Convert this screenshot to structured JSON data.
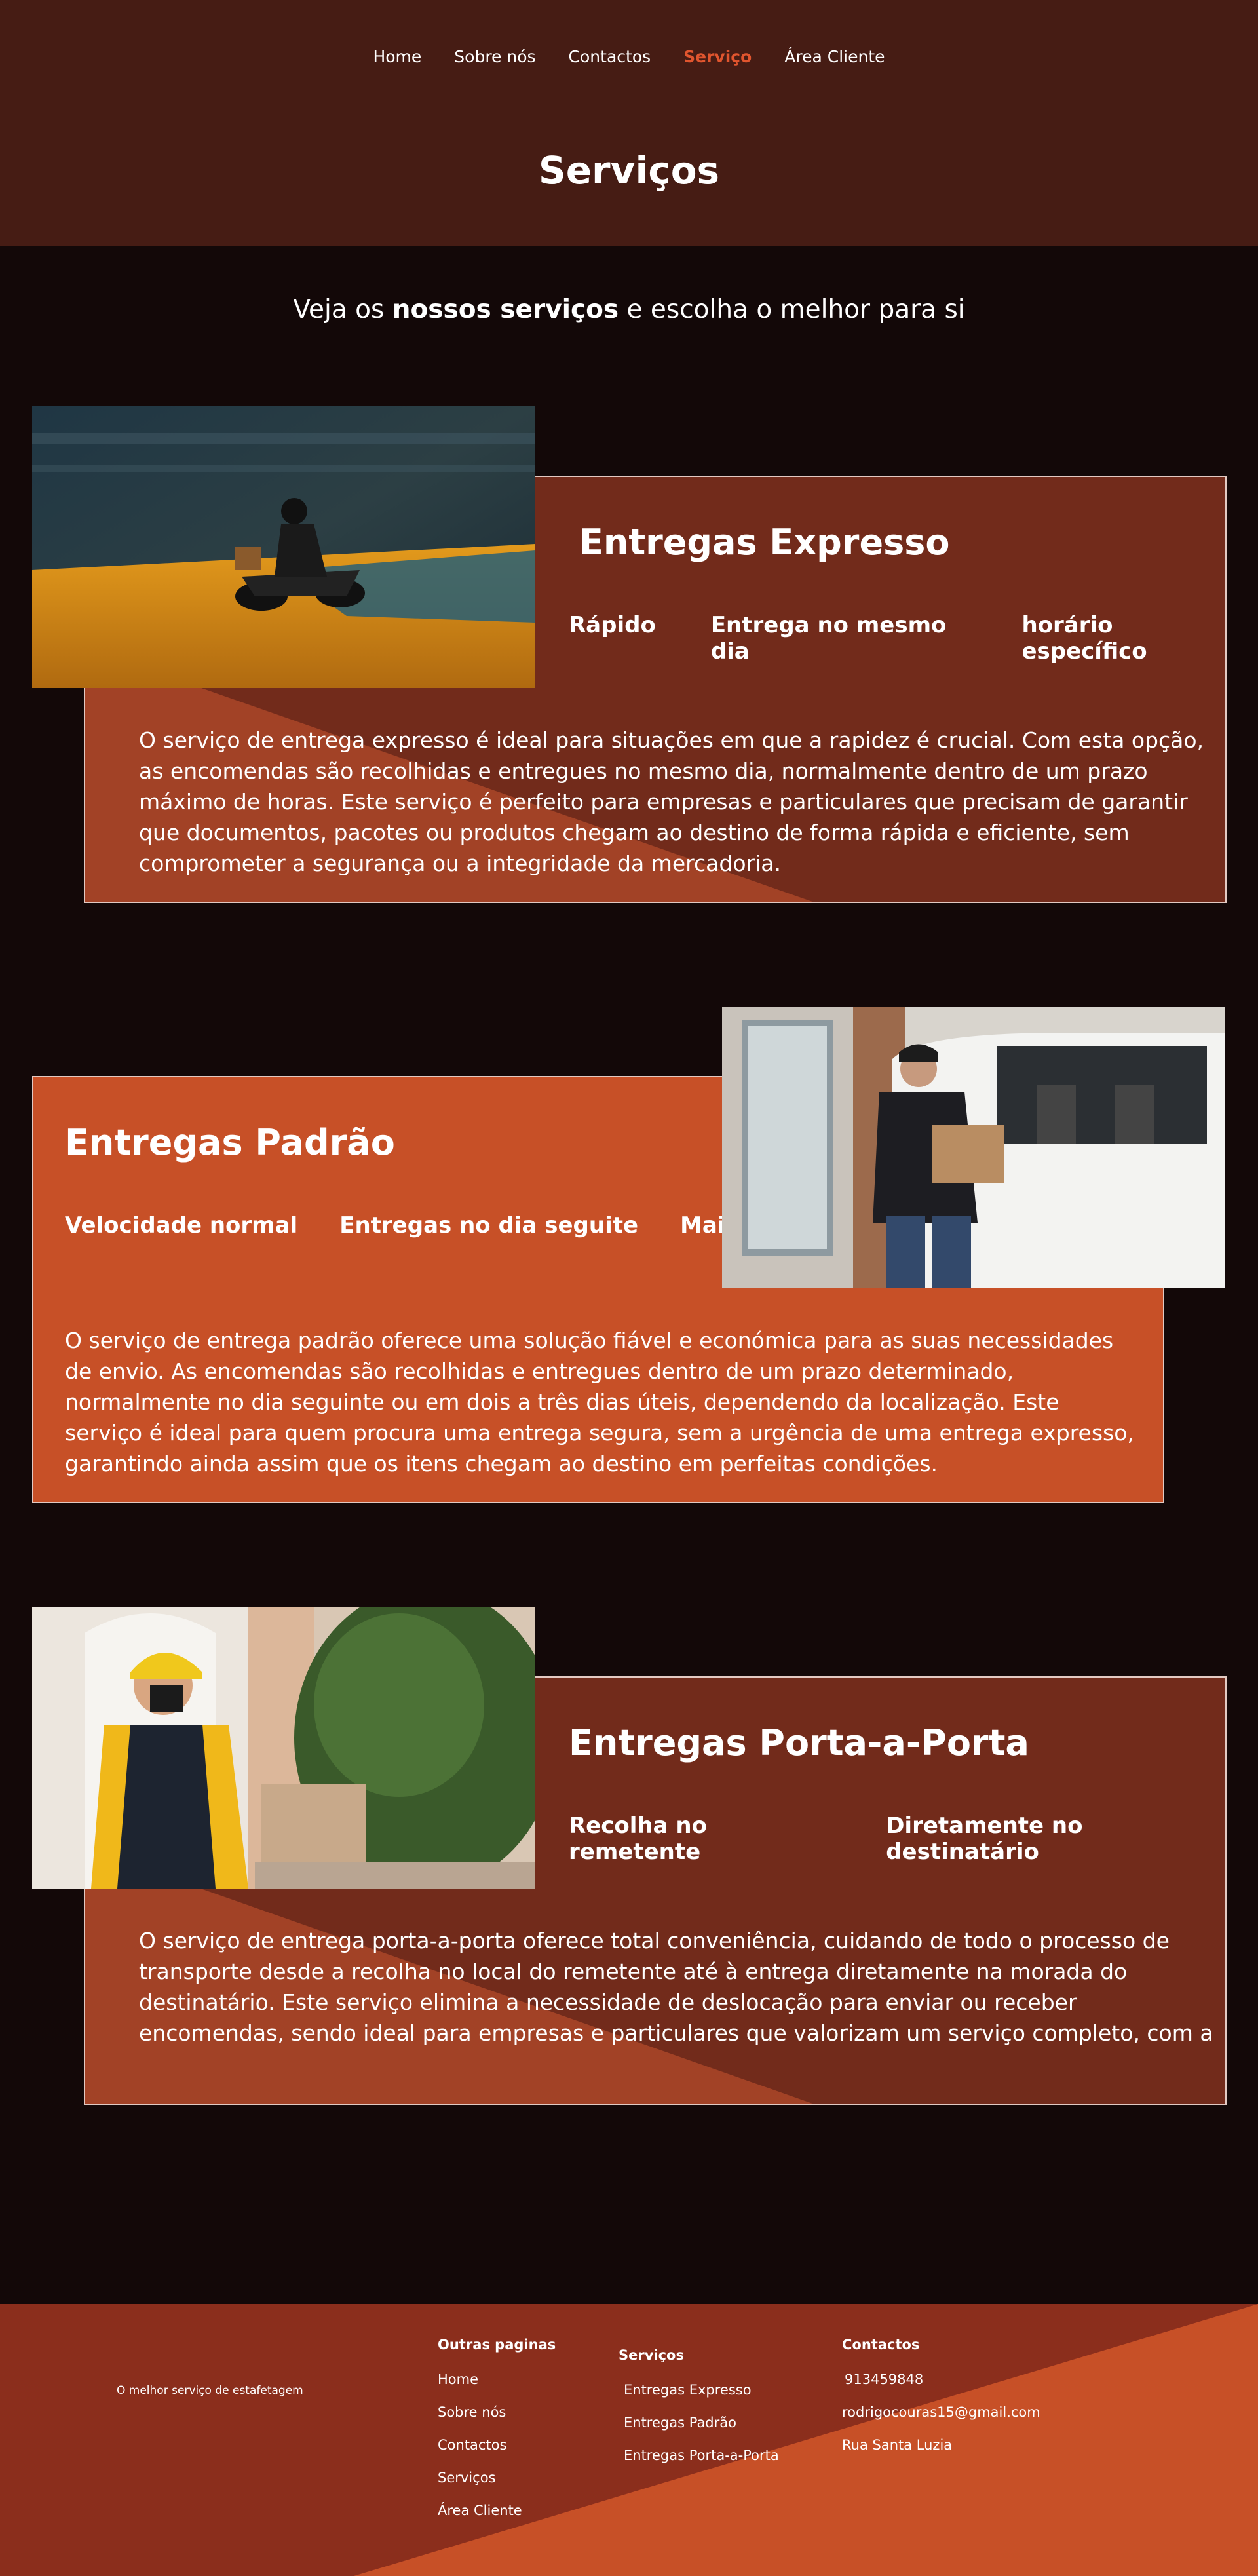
{
  "nav": {
    "items": [
      "Home",
      "Sobre nós",
      "Contactos",
      "Serviço",
      "Área Cliente"
    ],
    "active_index": 3
  },
  "header": {
    "title": "Serviços"
  },
  "intro": {
    "prefix": "Veja os ",
    "bold": "nossos serviços",
    "suffix": " e escolha o melhor para si"
  },
  "services": [
    {
      "title": "Entregas Expresso",
      "tags": [
        "Rápido",
        "Entrega no mesmo dia",
        "horário específico"
      ],
      "description": "O serviço de entrega expresso é ideal para situações em que a rapidez é crucial. Com esta opção, as encomendas são recolhidas e entregues no mesmo dia, normalmente dentro de um prazo máximo de horas. Este serviço é perfeito para empresas e particulares que precisam de garantir que documentos, pacotes ou produtos chegam ao destino de forma rápida e eficiente, sem comprometer a segurança ou a integridade da mercadoria."
    },
    {
      "title": "Entregas Padrão",
      "tags": [
        "Velocidade normal",
        "Entregas no dia seguite",
        "Mais caro"
      ],
      "description": "O serviço de entrega padrão oferece uma solução fiável e económica para as suas necessidades de envio. As encomendas são recolhidas e entregues dentro de um prazo determinado, normalmente no dia seguinte ou em dois a três dias úteis, dependendo da localização. Este serviço é ideal para quem procura uma entrega segura, sem a urgência de uma entrega expresso, garantindo ainda assim que os itens chegam ao destino em perfeitas condições."
    },
    {
      "title": "Entregas Porta-a-Porta",
      "tags": [
        "Recolha no remetente",
        "Diretamente no destinatário"
      ],
      "description": "O serviço de entrega porta-a-porta oferece total conveniência, cuidando de todo o processo de transporte desde a recolha no local do remetente até à entrega diretamente na morada do destinatário. Este serviço elimina a necessidade de deslocação para enviar ou receber encomendas, sendo ideal para empresas e particulares que valorizam um serviço completo, com a segurança adicional de saber que a"
    }
  ],
  "footer": {
    "tagline": "O melhor serviço de estafetagem",
    "other_pages": {
      "heading": "Outras paginas",
      "links": [
        "Home",
        "Sobre nós",
        "Contactos",
        "Serviços",
        "Área Cliente"
      ]
    },
    "services": {
      "heading": "Serviços",
      "links": [
        "Entregas Expresso",
        "Entregas Padrão",
        "Entregas Porta-a-Porta"
      ]
    },
    "contacts": {
      "heading": "Contactos",
      "phone": "913459848",
      "email": "rodrigocouras15@gmail.com",
      "address": "Rua Santa Luzia"
    }
  },
  "colors": {
    "header_bg": "#461c14",
    "page_bg": "#130808",
    "card_dark": "#722b1b",
    "card_orange": "#c75027",
    "accent": "#e1552e",
    "footer_bg": "#8b2e1c"
  }
}
